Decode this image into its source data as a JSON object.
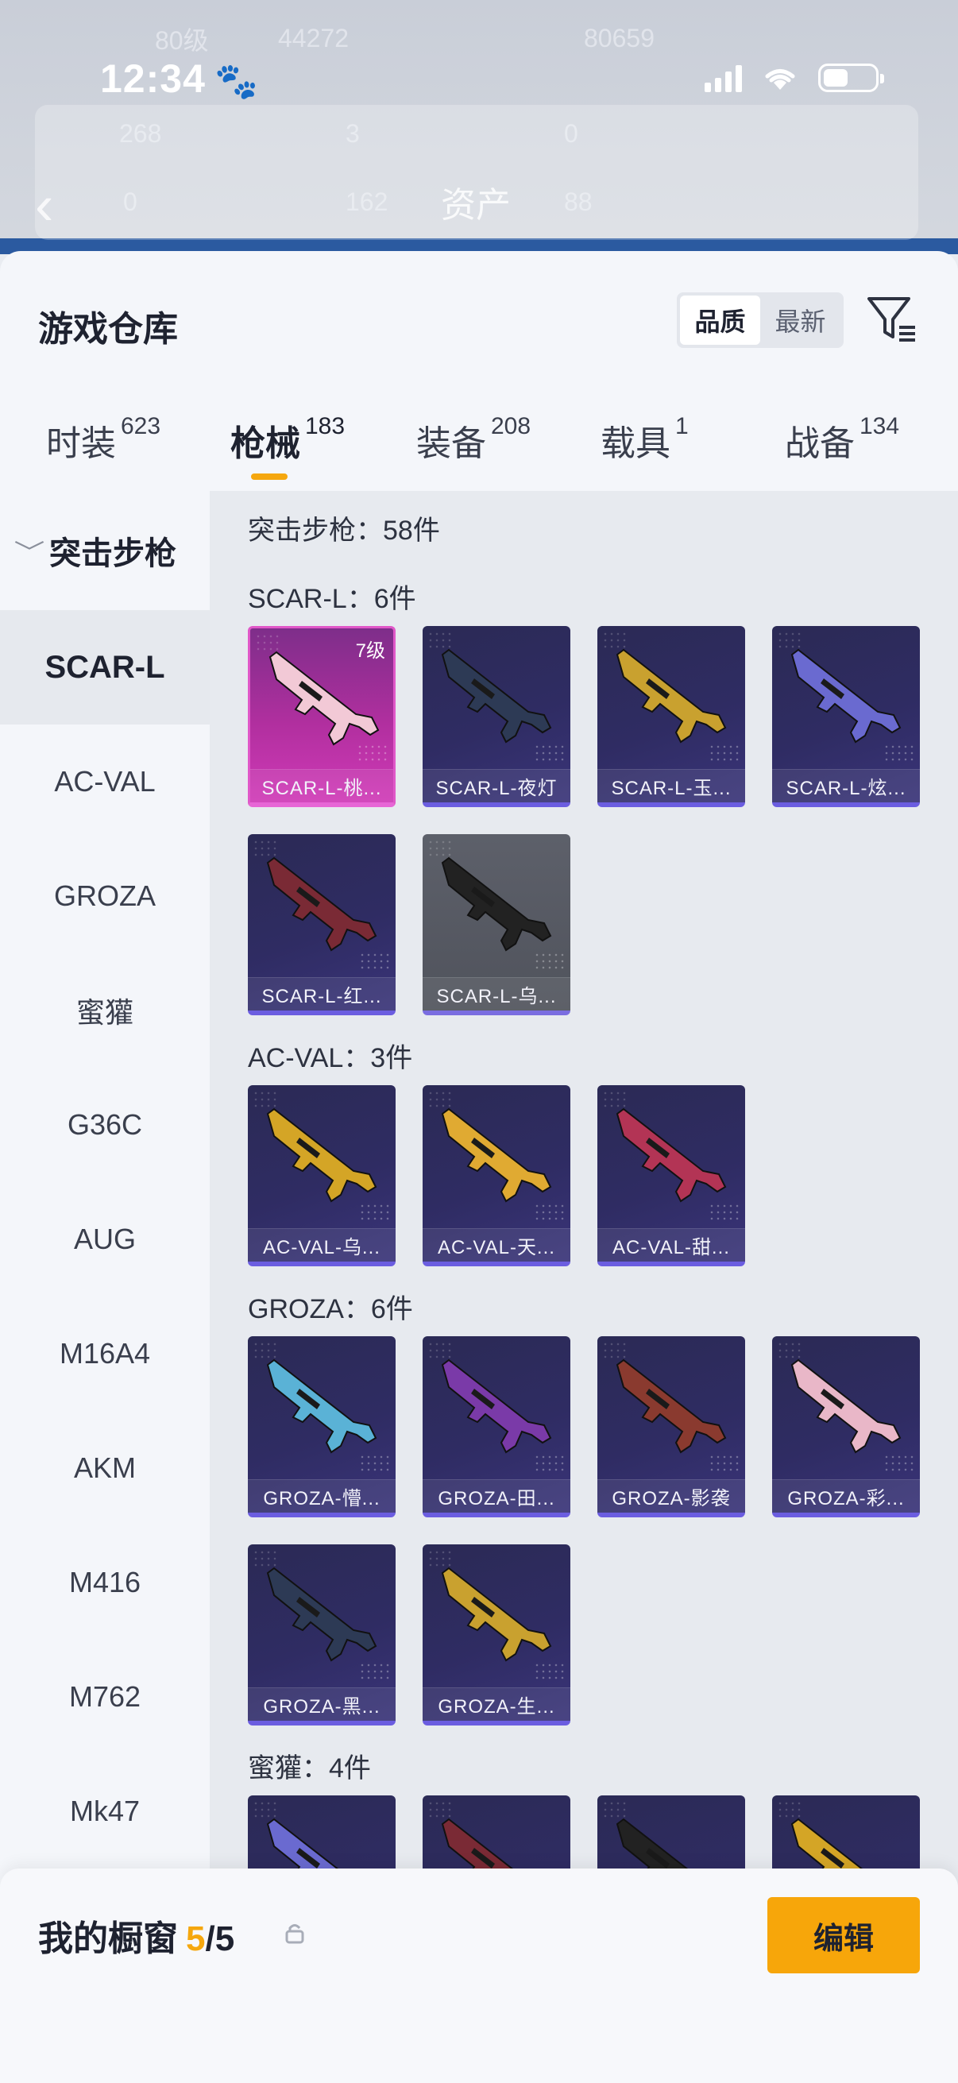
{
  "status_bar": {
    "time": "12:34"
  },
  "background_header": {
    "level_text": "80级",
    "coins_text": "44272",
    "score_text": "80659",
    "stat_1": "268",
    "stat_2": "3",
    "stat_3": "0",
    "stat_4": "0",
    "stat_5": "162",
    "stat_6": "88",
    "title": "资产"
  },
  "sheet": {
    "title": "游戏仓库",
    "sort_options": [
      "品质",
      "最新"
    ],
    "active_sort": "品质"
  },
  "tabs": [
    {
      "label": "时装",
      "count": "623"
    },
    {
      "label": "枪械",
      "count": "183"
    },
    {
      "label": "装备",
      "count": "208"
    },
    {
      "label": "载具",
      "count": "1"
    },
    {
      "label": "战备",
      "count": "134"
    }
  ],
  "sidebar": {
    "category": "突击步枪",
    "items": [
      "SCAR-L",
      "AC-VAL",
      "GROZA",
      "蜜獾",
      "G36C",
      "AUG",
      "M16A4",
      "AKM",
      "M416",
      "M762",
      "Mk47"
    ]
  },
  "content": {
    "summary": "突击步枪：58件",
    "groups": [
      {
        "title": "SCAR-L：6件",
        "items": [
          {
            "name": "SCAR-L-桃...",
            "level": "7级",
            "style": "pink"
          },
          {
            "name": "SCAR-L-夜灯",
            "style": "purple"
          },
          {
            "name": "SCAR-L-玉...",
            "style": "purple"
          },
          {
            "name": "SCAR-L-炫...",
            "style": "purple"
          },
          {
            "name": "SCAR-L-红...",
            "style": "purple"
          },
          {
            "name": "SCAR-L-乌...",
            "style": "gray"
          }
        ]
      },
      {
        "title": "AC-VAL：3件",
        "items": [
          {
            "name": "AC-VAL-乌...",
            "style": "purple"
          },
          {
            "name": "AC-VAL-天...",
            "style": "purple"
          },
          {
            "name": "AC-VAL-甜...",
            "style": "purple"
          }
        ]
      },
      {
        "title": "GROZA：6件",
        "items": [
          {
            "name": "GROZA-懵...",
            "style": "purple"
          },
          {
            "name": "GROZA-田...",
            "style": "purple"
          },
          {
            "name": "GROZA-影袭",
            "style": "purple"
          },
          {
            "name": "GROZA-彩...",
            "style": "purple"
          },
          {
            "name": "GROZA-黑...",
            "style": "purple"
          },
          {
            "name": "GROZA-生...",
            "style": "purple"
          }
        ]
      },
      {
        "title": "蜜獾：4件",
        "items": []
      }
    ]
  },
  "bottom_bar": {
    "label": "我的橱窗",
    "current": "5",
    "total": "/5",
    "edit_label": "编辑"
  },
  "colors": {
    "accent": "#f7a60a",
    "tab_underline": "#f5a70e",
    "card_purple": "#2f2c63",
    "card_pink": "#b12f9f",
    "card_gray": "#55585f"
  }
}
